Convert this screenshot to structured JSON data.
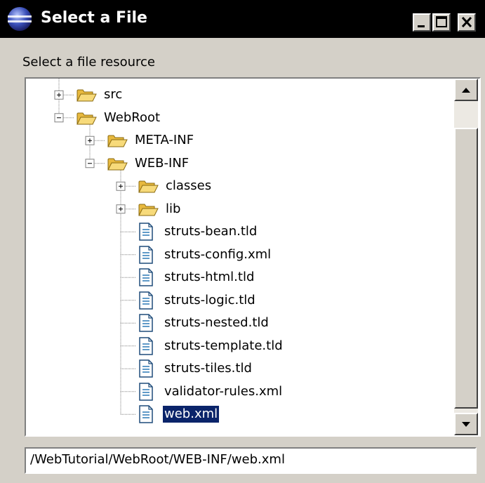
{
  "window": {
    "title": "Select a File",
    "icon": "eclipse-globe-icon",
    "controls": [
      "minimize-icon",
      "maximize-icon",
      "close-icon"
    ]
  },
  "dialog": {
    "prompt": "Select a file resource"
  },
  "tree": {
    "nodes": [
      {
        "label": "src",
        "type": "folder",
        "depth": 0,
        "expander": "plus"
      },
      {
        "label": "WebRoot",
        "type": "folder",
        "depth": 0,
        "expander": "minus"
      },
      {
        "label": "META-INF",
        "type": "folder",
        "depth": 1,
        "expander": "plus"
      },
      {
        "label": "WEB-INF",
        "type": "folder",
        "depth": 1,
        "expander": "minus"
      },
      {
        "label": "classes",
        "type": "folder",
        "depth": 2,
        "expander": "plus"
      },
      {
        "label": "lib",
        "type": "folder",
        "depth": 2,
        "expander": "plus"
      },
      {
        "label": "struts-bean.tld",
        "type": "file",
        "depth": 2
      },
      {
        "label": "struts-config.xml",
        "type": "file",
        "depth": 2
      },
      {
        "label": "struts-html.tld",
        "type": "file",
        "depth": 2
      },
      {
        "label": "struts-logic.tld",
        "type": "file",
        "depth": 2
      },
      {
        "label": "struts-nested.tld",
        "type": "file",
        "depth": 2
      },
      {
        "label": "struts-template.tld",
        "type": "file",
        "depth": 2
      },
      {
        "label": "struts-tiles.tld",
        "type": "file",
        "depth": 2
      },
      {
        "label": "validator-rules.xml",
        "type": "file",
        "depth": 2
      },
      {
        "label": "web.xml",
        "type": "file",
        "depth": 2,
        "selected": true
      }
    ]
  },
  "path_field": {
    "value": "/WebTutorial/WebRoot/WEB-INF/web.xml"
  },
  "colors": {
    "titlebar": "#000000",
    "selection": "#0a246a",
    "face": "#d4d0c8",
    "folder": "#f4d36b"
  }
}
